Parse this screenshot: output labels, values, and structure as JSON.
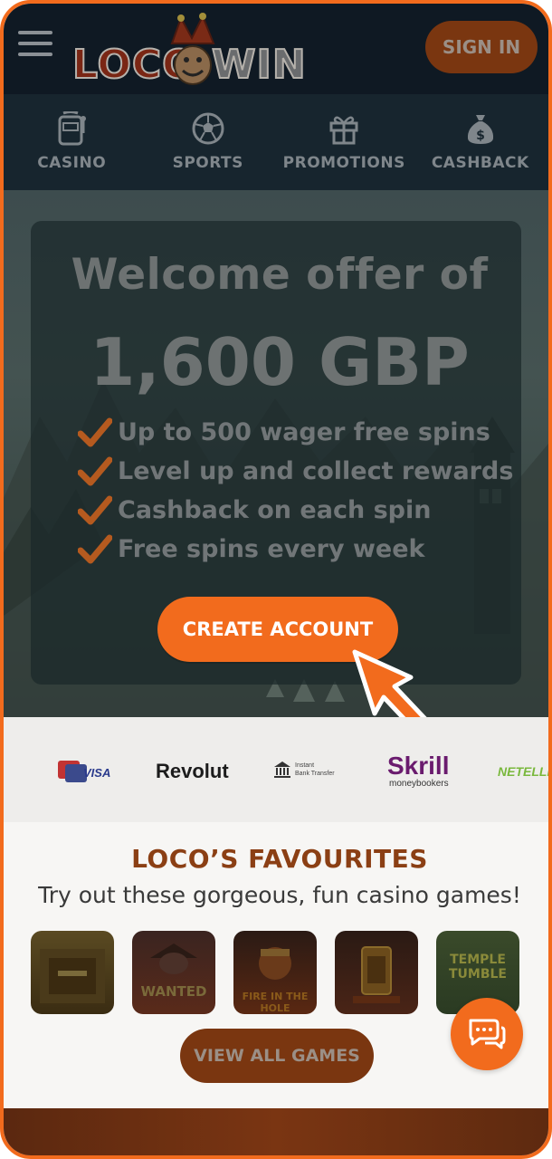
{
  "header": {
    "logo_left": "LOCO",
    "logo_right": "WIN",
    "signin_label": "SIGN IN"
  },
  "nav": {
    "items": [
      {
        "label": "CASINO",
        "icon": "slot-machine-icon"
      },
      {
        "label": "SPORTS",
        "icon": "football-icon"
      },
      {
        "label": "PROMOTIONS",
        "icon": "gift-icon"
      },
      {
        "label": "CASHBACK",
        "icon": "money-bag-icon"
      }
    ]
  },
  "hero": {
    "title": "Welcome offer of",
    "amount": "1,600 GBP",
    "bullets": [
      "Up to 500 wager free spins",
      "Level up and collect rewards",
      "Cashback on each spin",
      "Free spins every week"
    ],
    "cta_label": "CREATE ACCOUNT"
  },
  "payments": {
    "visa": "VISA",
    "revolut": "Revolut",
    "bank_line1": "Instant",
    "bank_line2": "Bank Transfer",
    "skrill": "Skrill",
    "skrill_sub": "moneybookers",
    "neteller": "NETELLER"
  },
  "favourites": {
    "title": "LOCO’S FAVOURITES",
    "subtitle": "Try out these gorgeous, fun casino games!",
    "games": [
      {
        "label": ""
      },
      {
        "label": "WANTED"
      },
      {
        "label": "FIRE IN THE HOLE"
      },
      {
        "label": ""
      },
      {
        "label": "TEMPLE TUMBLE"
      }
    ],
    "view_all_label": "VIEW ALL GAMES"
  },
  "colors": {
    "accent": "#f26b1d",
    "header_bg": "#0f1923",
    "nav_bg": "#17252e"
  }
}
